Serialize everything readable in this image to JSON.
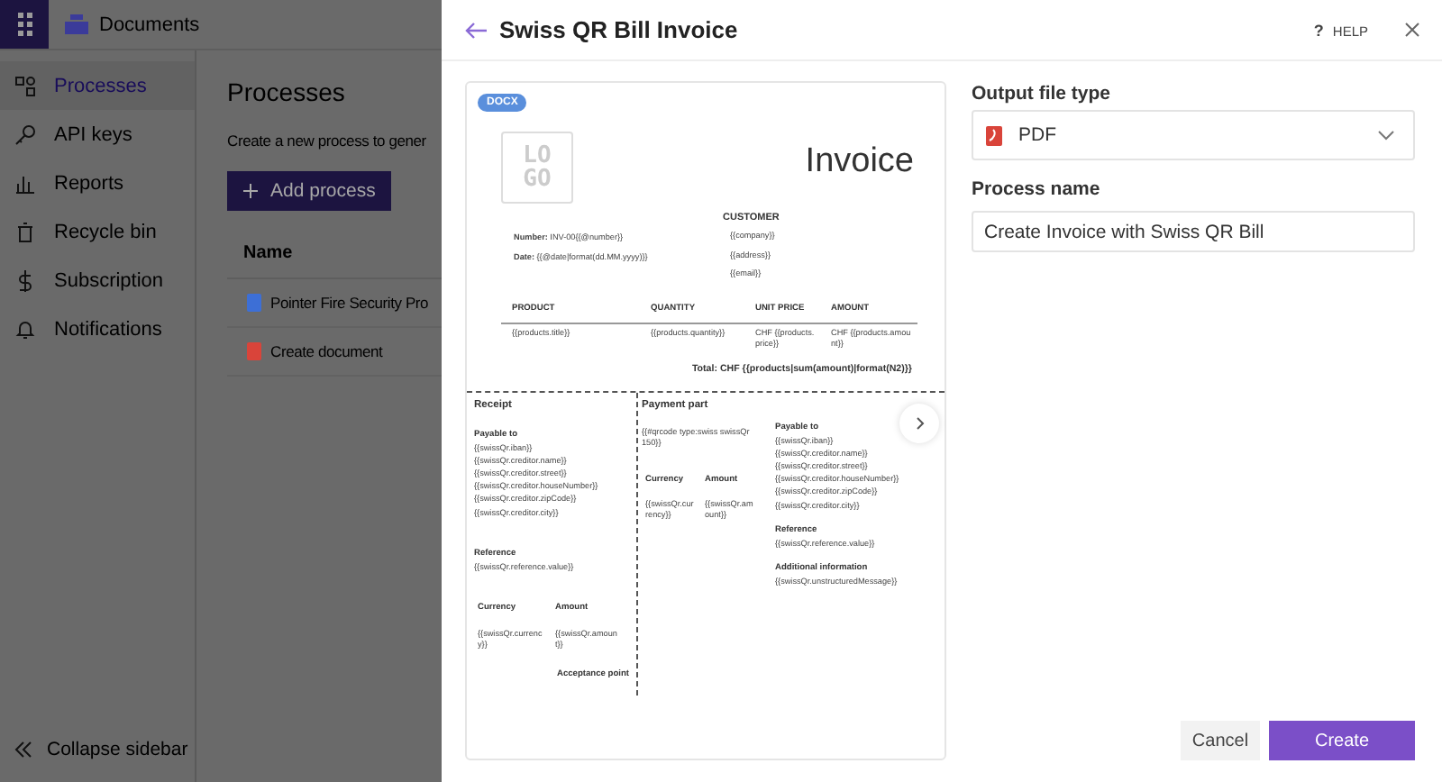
{
  "app": {
    "product": "Documents",
    "sidebar": [
      {
        "label": "Processes",
        "kind": "processes",
        "selected": true
      },
      {
        "label": "API keys",
        "kind": "keys",
        "selected": false
      },
      {
        "label": "Reports",
        "kind": "reports",
        "selected": false
      },
      {
        "label": "Recycle bin",
        "kind": "bin",
        "selected": false
      },
      {
        "label": "Subscription",
        "kind": "subscription",
        "selected": false
      },
      {
        "label": "Notifications",
        "kind": "notifications",
        "selected": false
      }
    ],
    "collapse": "Collapse sidebar"
  },
  "page": {
    "title": "Processes",
    "subtitle": "Create a new process to gener",
    "add_button": "Add process",
    "table": {
      "columns": [
        "Name"
      ],
      "rows": [
        {
          "name": "Pointer Fire Security Pro",
          "kind": "docx"
        },
        {
          "name": "Create document",
          "kind": "pdf"
        }
      ]
    }
  },
  "dialog": {
    "title": "Swiss QR Bill Invoice",
    "help_mark": "?",
    "help": "HELP",
    "preview": {
      "badge": "DOCX",
      "logo": "LOGO",
      "title": "Invoice",
      "customer_heading": "CUSTOMER",
      "meta": [
        "**Number:** INV-00{{@number}}",
        "**Date:** {{@date|format(dd.MM.yyyy)}}"
      ],
      "customer": [
        "{{company}}",
        "{{address}}",
        "{{email}}"
      ],
      "columns": [
        "PRODUCT",
        "QUANTITY",
        "UNIT PRICE",
        "AMOUNT"
      ],
      "row": [
        "{{products.title}}",
        "{{products.quantity}}",
        "CHF {{products.price}}",
        "CHF {{products.amount}}"
      ],
      "total": "Total: CHF {{products|sum(amount)|format(N2)}}",
      "receipt": {
        "heading": "Receipt",
        "payable_heading": "Payable to",
        "payable": [
          "{{swissQr.iban}}",
          "{{swissQr.creditor.name}}",
          "{{swissQr.creditor.street}}",
          "{{swissQr.creditor.houseNumber}}",
          "{{swissQr.creditor.zipCode}}",
          "{{swissQr.creditor.city}}"
        ],
        "reference_heading": "Reference",
        "reference": "{{swissQr.reference.value}}",
        "currency_heading": "Currency",
        "amount_heading": "Amount",
        "currency": "{{swissQr.currency}}",
        "amount": "{{swissQr.amount}}",
        "acceptance": "Acceptance point"
      },
      "payment": {
        "heading": "Payment part",
        "qrcode": "{{#qrcode type:swiss swissQr 150}}",
        "currency_heading": "Currency",
        "amount_heading": "Amount",
        "currency": "{{swissQr.currency}}",
        "amount": "{{swissQr.amount}}",
        "payable_heading": "Payable to",
        "payable": [
          "{{swissQr.iban}}",
          "{{swissQr.creditor.name}}",
          "{{swissQr.creditor.street}}",
          "{{swissQr.creditor.houseNumber}}",
          "{{swissQr.creditor.zipCode}}",
          "{{swissQr.creditor.city}}"
        ],
        "reference_heading": "Reference",
        "reference": "{{swissQr.reference.value}}",
        "info_heading": "Additional information",
        "info": "{{swissQr.unstructuredMessage}}"
      }
    },
    "output_label": "Output file type",
    "output_value": "PDF",
    "name_label": "Process name",
    "name_value": "Create Invoice with Swiss QR Bill",
    "cancel": "Cancel",
    "create": "Create"
  }
}
